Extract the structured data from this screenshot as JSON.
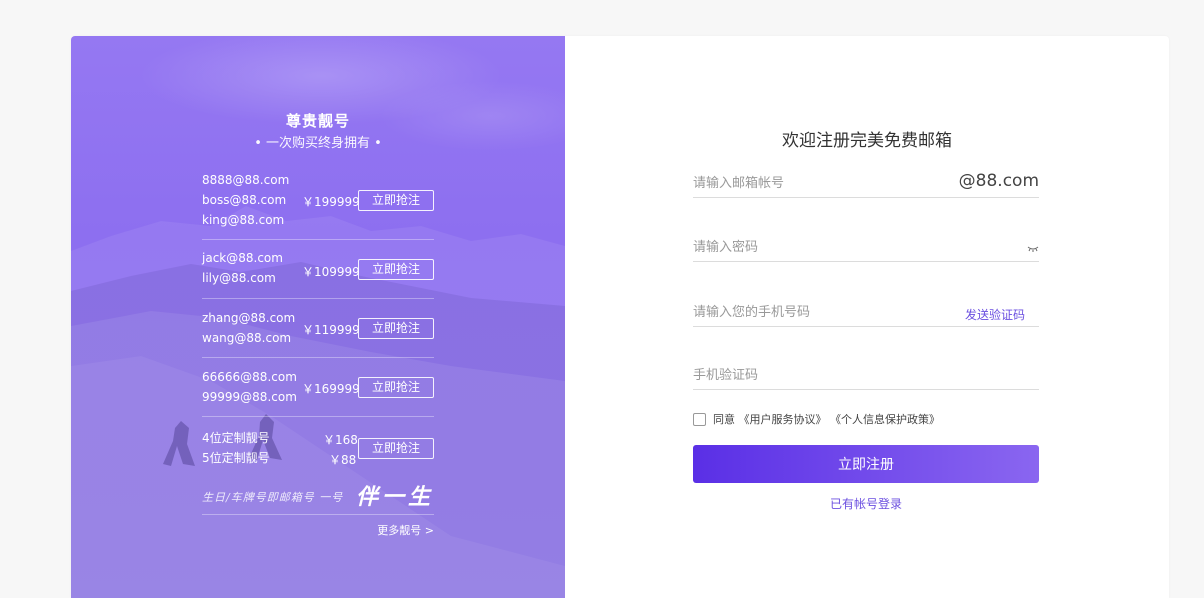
{
  "hero": {
    "title": "尊贵靓号",
    "subtitle": "• 一次购买终身拥有 •"
  },
  "offers": [
    {
      "accounts": [
        "8888@88.com",
        "boss@88.com",
        "king@88.com"
      ],
      "price": "￥199999",
      "button": "立即抢注"
    },
    {
      "accounts": [
        "jack@88.com",
        "lily@88.com"
      ],
      "price": "￥109999",
      "button": "立即抢注"
    },
    {
      "accounts": [
        "zhang@88.com",
        "wang@88.com"
      ],
      "price": "￥119999",
      "button": "立即抢注"
    },
    {
      "accounts": [
        "66666@88.com",
        "99999@88.com"
      ],
      "price": "￥169999",
      "button": "立即抢注"
    },
    {
      "accounts": [
        "4位定制靓号",
        "5位定制靓号"
      ],
      "prices": [
        "￥168",
        "￥88"
      ],
      "button": "立即抢注"
    }
  ],
  "slogan": {
    "small": "生日/车牌号即邮箱号 一号",
    "big": "伴一生"
  },
  "more_link": "更多靓号 >",
  "form": {
    "title": "欢迎注册完美免费邮箱",
    "email_placeholder": "请输入邮箱帐号",
    "email_suffix": "@88.com",
    "password_placeholder": "请输入密码",
    "phone_placeholder": "请输入您的手机号码",
    "send_code": "发送验证码",
    "code_placeholder": "手机验证码",
    "agree_prefix": "同意",
    "agreement_1": "《用户服务协议》",
    "agreement_2": "《个人信息保护政策》",
    "submit": "立即注册",
    "login_link": "已有帐号登录"
  },
  "colors": {
    "accent": "#6b4fe0",
    "panel": "#8f73f0",
    "button_start": "#5a2fe6",
    "button_end": "#8a66f0"
  },
  "icons": {
    "password_toggle": "eye-closed-icon"
  }
}
